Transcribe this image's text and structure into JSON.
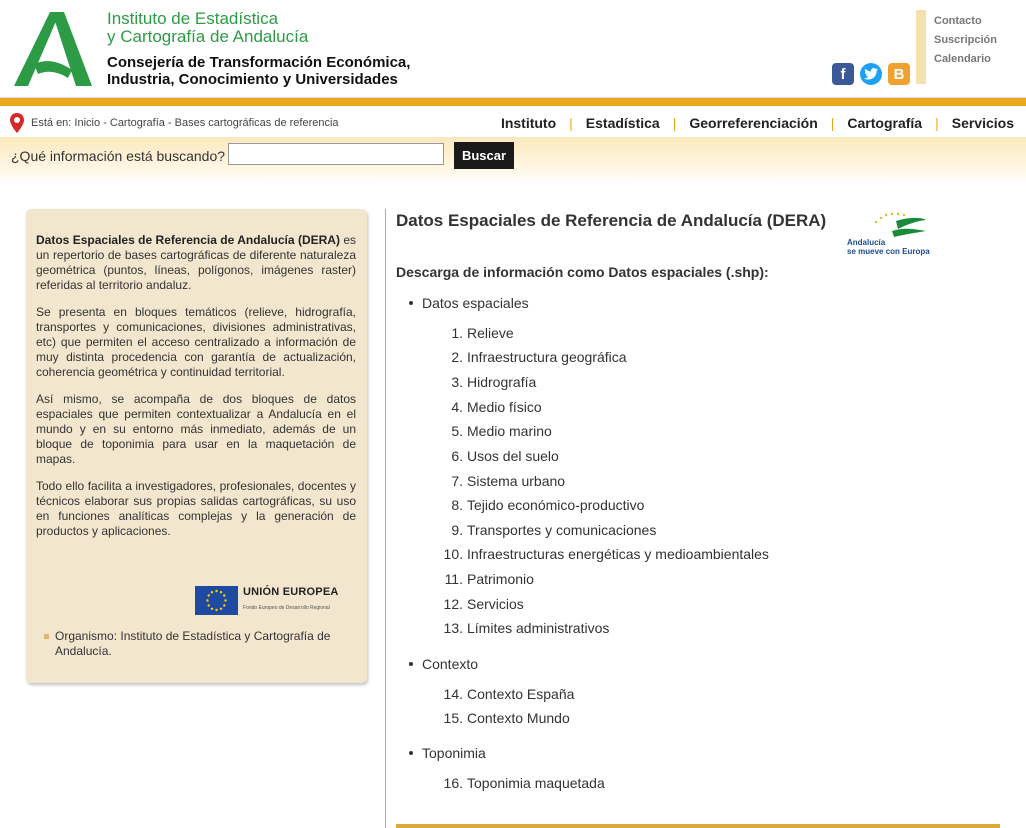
{
  "header": {
    "institute_line1": "Instituto de Estadística",
    "institute_line2": "y Cartografía de Andalucía",
    "consejeria_line1": "Consejería de Transformación Económica,",
    "consejeria_line2": "Industria, Conocimiento y Universidades",
    "top_links": [
      "Contacto",
      "Suscripción",
      "Calendario"
    ],
    "social": [
      "facebook-icon",
      "twitter-icon",
      "blogger-icon"
    ]
  },
  "nav": {
    "breadcrumb": "Está en: Inicio - Cartografía - Bases cartográficas de referencia",
    "items": [
      "Instituto",
      "Estadística",
      "Georreferenciación",
      "Cartografía",
      "Servicios"
    ],
    "separator": "|"
  },
  "search": {
    "label": "¿Qué información está buscando?",
    "value": "",
    "button": "Buscar"
  },
  "sidebar": {
    "p1_bold": "Datos Espaciales de Referencia de Andalucía (DERA)",
    "p1_rest": " es un repertorio de bases cartográficas de diferente naturaleza geométrica (puntos, líneas, polígonos, imágenes raster) referidas al territorio andaluz.",
    "p2": "Se presenta en bloques temáticos (relieve, hidrografía, transportes y comunicaciones, divisiones administrativas, etc) que permiten el acceso centralizado a información de muy distinta procedencia con garantía de actualización, coherencia geométrica y continuidad territorial.",
    "p3": "Así mismo, se acompaña de dos bloques de datos espaciales que permiten contextualizar a Andalucía en el mundo y en su entorno más inmediato, además de un bloque de toponimia para usar en la maquetación de mapas.",
    "p4": "Todo ello facilita a investigadores, profesionales, docentes y técnicos elaborar sus propias salidas cartográficas, su uso en funciones analíticas complejas y la generación de productos y aplicaciones.",
    "eu_title": "UNIÓN EUROPEA",
    "eu_sub": "Fondo Europeo de Desarrollo Regional",
    "org": "Organismo: Instituto de Estadística y Cartografía de Andalucía."
  },
  "main": {
    "title": "Datos Espaciales de Referencia de Andalucía (DERA)",
    "badge_line1": "Andalucía",
    "badge_line2": "se mueve con Europa",
    "subtitle": "Descarga de información como Datos espaciales (.shp):",
    "categories": [
      {
        "label": "Datos espaciales",
        "items": [
          {
            "n": "1.",
            "label": "Relieve"
          },
          {
            "n": "2.",
            "label": "Infraestructura geográfica"
          },
          {
            "n": "3.",
            "label": "Hidrografía"
          },
          {
            "n": "4.",
            "label": "Medio físico"
          },
          {
            "n": "5.",
            "label": "Medio marino"
          },
          {
            "n": "6.",
            "label": "Usos del suelo"
          },
          {
            "n": "7.",
            "label": "Sistema urbano"
          },
          {
            "n": "8.",
            "label": "Tejido económico-productivo"
          },
          {
            "n": "9.",
            "label": "Transportes y comunicaciones"
          },
          {
            "n": "10.",
            "label": "Infraestructuras energéticas y medioambientales"
          },
          {
            "n": "11.",
            "label": "Patrimonio"
          },
          {
            "n": "12.",
            "label": "Servicios"
          },
          {
            "n": "13.",
            "label": "Límites administrativos"
          }
        ]
      },
      {
        "label": "Contexto",
        "items": [
          {
            "n": "14.",
            "label": "Contexto España"
          },
          {
            "n": "15.",
            "label": "Contexto Mundo"
          }
        ]
      },
      {
        "label": "Toponimia",
        "items": [
          {
            "n": "16.",
            "label": "Toponimia maquetada"
          }
        ]
      }
    ]
  }
}
